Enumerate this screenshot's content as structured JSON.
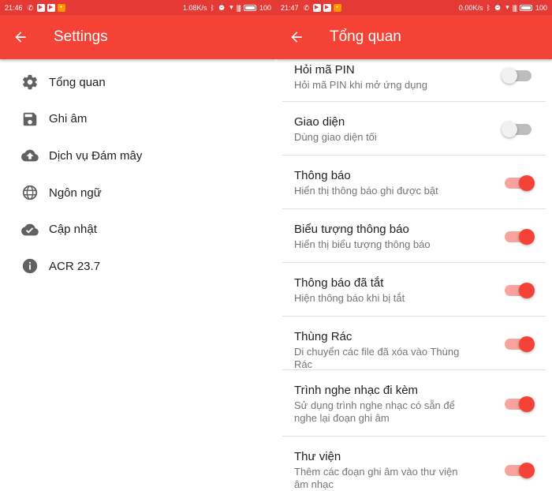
{
  "left": {
    "status": {
      "time": "21:46",
      "speed": "1.08K/s",
      "battery": "100"
    },
    "title": "Settings",
    "menu": [
      {
        "label": "Tổng quan",
        "icon": "gear-icon"
      },
      {
        "label": "Ghi âm",
        "icon": "save-icon"
      },
      {
        "label": "Dịch vụ Đám mây",
        "icon": "cloud-upload-icon"
      },
      {
        "label": "Ngôn ngữ",
        "icon": "globe-icon"
      },
      {
        "label": "Cập nhật",
        "icon": "cloud-check-icon"
      },
      {
        "label": "ACR 23.7",
        "icon": "info-icon"
      }
    ]
  },
  "right": {
    "status": {
      "time": "21:47",
      "speed": "0.00K/s",
      "battery": "100"
    },
    "title": "Tổng quan",
    "settings": [
      {
        "title": "Hỏi mã PIN",
        "subtitle": "Hỏi mã PIN khi mở ứng dụng",
        "enabled": false
      },
      {
        "title": "Giao diện",
        "subtitle": "Dùng giao diện tối",
        "enabled": false
      },
      {
        "title": "Thông báo",
        "subtitle": "Hiển thị thông báo ghi được bật",
        "enabled": true
      },
      {
        "title": "Biểu tượng thông báo",
        "subtitle": "Hiển thị biểu tượng thông báo",
        "enabled": true
      },
      {
        "title": "Thông báo đã tắt",
        "subtitle": "Hiện thông báo khi bị tắt",
        "enabled": true
      },
      {
        "title": "Thùng Rác",
        "subtitle": "Di chuyển các file đã xóa vào Thùng Rác",
        "enabled": true
      },
      {
        "title": "Trình nghe nhạc đi kèm",
        "subtitle": "Sử dụng trình nghe nhạc có sẵn để nghe lại đoạn ghi âm",
        "enabled": true
      },
      {
        "title": "Thư viện",
        "subtitle": "Thêm các đoạn ghi âm vào thư viện âm nhạc",
        "enabled": true
      }
    ]
  },
  "colors": {
    "primary": "#f44336",
    "statusbar": "#e53935",
    "switch_track_on": "#f8a39d"
  }
}
